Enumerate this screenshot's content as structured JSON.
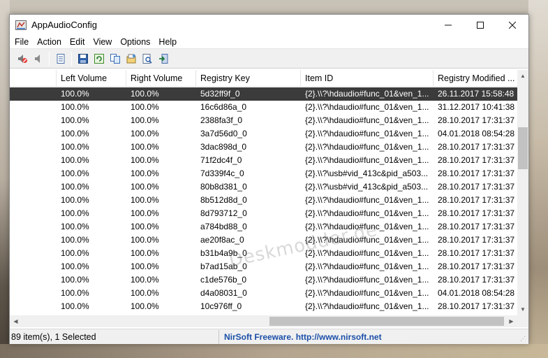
{
  "window": {
    "title": "AppAudioConfig",
    "controls": {
      "minimize": "—",
      "maximize": "☐",
      "close": "✕"
    }
  },
  "menu": [
    "File",
    "Action",
    "Edit",
    "View",
    "Options",
    "Help"
  ],
  "toolbar": {
    "buttons": [
      "mute-icon",
      "speaker-icon",
      "properties-icon",
      "save-icon",
      "refresh-icon",
      "copy-icon",
      "html-report-icon",
      "find-icon",
      "exit-icon"
    ]
  },
  "table": {
    "columns": [
      "",
      "Left Volume",
      "Right Volume",
      "Registry Key",
      "Item ID",
      "Registry Modified ..."
    ],
    "selected_index": 0,
    "rows": [
      [
        "",
        "100.0%",
        "100.0%",
        "5d32ff9f_0",
        "{2}.\\\\?\\hdaudio#func_01&ven_1...",
        "26.11.2017 15:58:48"
      ],
      [
        "",
        "100.0%",
        "100.0%",
        "16c6d86a_0",
        "{2}.\\\\?\\hdaudio#func_01&ven_1...",
        "31.12.2017 10:41:38"
      ],
      [
        "",
        "100.0%",
        "100.0%",
        "2388fa3f_0",
        "{2}.\\\\?\\hdaudio#func_01&ven_1...",
        "28.10.2017 17:31:37"
      ],
      [
        "",
        "100.0%",
        "100.0%",
        "3a7d56d0_0",
        "{2}.\\\\?\\hdaudio#func_01&ven_1...",
        "04.01.2018 08:54:28"
      ],
      [
        "",
        "100.0%",
        "100.0%",
        "3dac898d_0",
        "{2}.\\\\?\\hdaudio#func_01&ven_1...",
        "28.10.2017 17:31:37"
      ],
      [
        "",
        "100.0%",
        "100.0%",
        "71f2dc4f_0",
        "{2}.\\\\?\\hdaudio#func_01&ven_1...",
        "28.10.2017 17:31:37"
      ],
      [
        "",
        "100.0%",
        "100.0%",
        "7d339f4c_0",
        "{2}.\\\\?\\usb#vid_413c&pid_a503...",
        "28.10.2017 17:31:37"
      ],
      [
        "",
        "100.0%",
        "100.0%",
        "80b8d381_0",
        "{2}.\\\\?\\usb#vid_413c&pid_a503...",
        "28.10.2017 17:31:37"
      ],
      [
        "",
        "100.0%",
        "100.0%",
        "8b512d8d_0",
        "{2}.\\\\?\\hdaudio#func_01&ven_1...",
        "28.10.2017 17:31:37"
      ],
      [
        "",
        "100.0%",
        "100.0%",
        "8d793712_0",
        "{2}.\\\\?\\hdaudio#func_01&ven_1...",
        "28.10.2017 17:31:37"
      ],
      [
        "",
        "100.0%",
        "100.0%",
        "a784bd88_0",
        "{2}.\\\\?\\hdaudio#func_01&ven_1...",
        "28.10.2017 17:31:37"
      ],
      [
        "",
        "100.0%",
        "100.0%",
        "ae20f8ac_0",
        "{2}.\\\\?\\hdaudio#func_01&ven_1...",
        "28.10.2017 17:31:37"
      ],
      [
        "",
        "100.0%",
        "100.0%",
        "b31b4a9b_0",
        "{2}.\\\\?\\hdaudio#func_01&ven_1...",
        "28.10.2017 17:31:37"
      ],
      [
        "",
        "100.0%",
        "100.0%",
        "b7ad15ab_0",
        "{2}.\\\\?\\hdaudio#func_01&ven_1...",
        "28.10.2017 17:31:37"
      ],
      [
        "",
        "100.0%",
        "100.0%",
        "c1de576b_0",
        "{2}.\\\\?\\hdaudio#func_01&ven_1...",
        "28.10.2017 17:31:37"
      ],
      [
        "",
        "100.0%",
        "100.0%",
        "d4a08031_0",
        "{2}.\\\\?\\hdaudio#func_01&ven_1...",
        "04.01.2018 08:54:28"
      ],
      [
        "",
        "100.0%",
        "100.0%",
        "10c976ff_0",
        "{2}.\\\\?\\hdaudio#func_01&ven_1...",
        "28.10.2017 17:31:37"
      ]
    ]
  },
  "status": {
    "count": "89 item(s), 1 Selected",
    "link": "NirSoft Freeware.  http://www.nirsoft.net"
  },
  "watermark": "Deskmodder.de",
  "colors": {
    "selected_row": "#3b3b3b",
    "link": "#1a4fa8"
  }
}
